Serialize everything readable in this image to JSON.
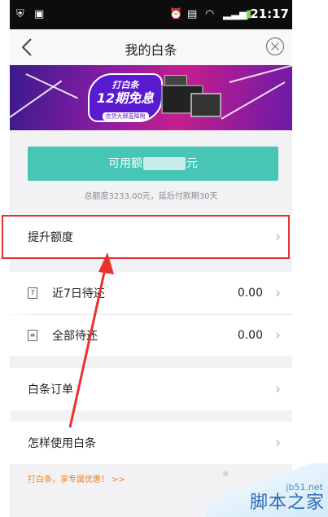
{
  "status_bar": {
    "time": "21:17"
  },
  "nav": {
    "title": "我的白条"
  },
  "banner": {
    "line1": "打白条",
    "line2": "12期免息",
    "line3": "信贷大牌直降购"
  },
  "credit": {
    "button_label_prefix": "可用额",
    "button_label_suffix": "元",
    "note": "总额度3233.00元，延后付款期30天"
  },
  "rows": {
    "raise_limit": "提升额度",
    "due7": {
      "label": "近7日待还",
      "amount": "0.00",
      "icon": "7"
    },
    "all_due": {
      "label": "全部待还",
      "amount": "0.00"
    },
    "orders": "白条订单",
    "howto": "怎样使用白条"
  },
  "promo": "打白条，享专属优惠！ >>",
  "watermark": {
    "site": "jb51.net",
    "cn": "脚本之家"
  },
  "colors": {
    "accent_teal": "#47c5b5",
    "highlight_red": "#e23434",
    "promo_orange": "#f08020"
  }
}
